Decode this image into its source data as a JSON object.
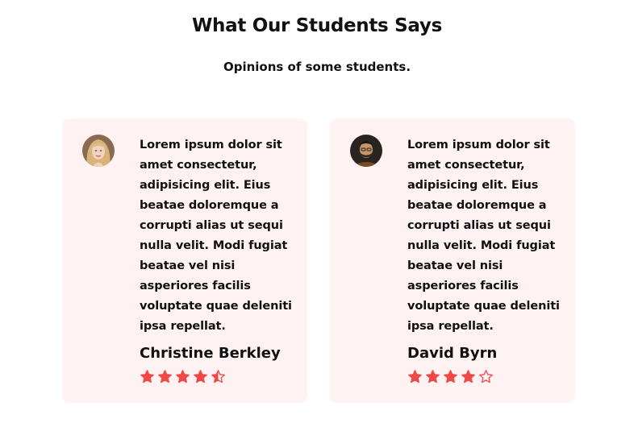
{
  "header": {
    "title": "What Our Students Says",
    "subtitle": "Opinions of some students."
  },
  "colors": {
    "card_background": "#fff2f2",
    "star_color": "#f04747"
  },
  "testimonials": [
    {
      "quote": "Lorem ipsum dolor sit amet consectetur, adipisicing elit. Eius beatae doloremque a corrupti alias ut sequi nulla velit. Modi fugiat beatae vel nisi asperiores facilis voluptate quae deleniti ipsa repellat.",
      "name": "Christine Berkley",
      "rating": 4.5,
      "rating_max": 5
    },
    {
      "quote": "Lorem ipsum dolor sit amet consectetur, adipisicing elit. Eius beatae doloremque a corrupti alias ut sequi nulla velit. Modi fugiat beatae vel nisi asperiores facilis voluptate quae deleniti ipsa repellat.",
      "name": "David Byrn",
      "rating": 4,
      "rating_max": 5
    }
  ]
}
